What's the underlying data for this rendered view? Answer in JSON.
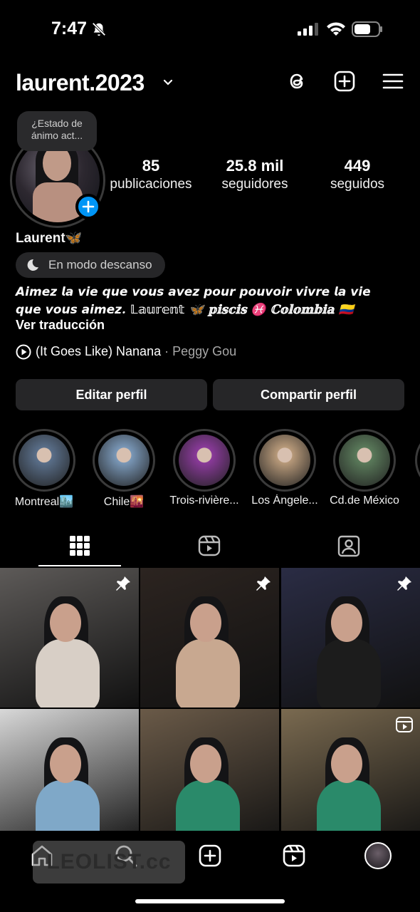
{
  "status_bar": {
    "time": "7:47"
  },
  "header": {
    "username": "laurent.2023"
  },
  "profile": {
    "note": "¿Estado de ánimo act...",
    "stats": [
      {
        "num": "85",
        "label": "publicaciones"
      },
      {
        "num": "25.8 mil",
        "label": "seguidores"
      },
      {
        "num": "449",
        "label": "seguidos"
      }
    ],
    "display_name": "Laurent🦋",
    "rest_mode": "En modo descanso",
    "bio": "𝘼𝙞𝙢𝙚𝙯 𝙡𝙖 𝙫𝙞𝙚 𝙦𝙪𝙚 𝙫𝙤𝙪𝙨 𝙖𝙫𝙚𝙯 𝙥𝙤𝙪𝙧 𝙥𝙤𝙪𝙫𝙤𝙞𝙧 𝙫𝙞𝙫𝙧𝙚 𝙡𝙖 𝙫𝙞𝙚 𝙦𝙪𝙚 𝙫𝙤𝙪𝙨 𝙖𝙞𝙢𝙚𝙯. 𝕃𝕒𝕦𝕣𝕖𝕟𝕥 🦋 𝕡𝕚𝕤𝕔𝕚𝕤 ♓ ℂ𝕠𝕝𝕠𝕞𝕓𝕚𝕒 🇨🇴",
    "translate": "Ver traducción",
    "song_title": "(It Goes Like) Nanana",
    "song_artist": " · Peggy Gou"
  },
  "buttons": {
    "edit": "Editar perfil",
    "share": "Compartir perfil"
  },
  "highlights": [
    {
      "label": "Montreal🏙️",
      "color": "#5a6f8a"
    },
    {
      "label": "Chile🌇",
      "color": "#7a98b8"
    },
    {
      "label": "Trois-rivière...",
      "color": "#8a3a9a"
    },
    {
      "label": "Los Ángele...",
      "color": "#b89a7a"
    },
    {
      "label": "Cd.de México",
      "color": "#5a7a5a"
    }
  ],
  "tabs": [
    "grid-icon",
    "reels-icon",
    "tagged-icon"
  ],
  "posts": [
    {
      "bg": "#5d5a58",
      "fig": "#d8cfc6",
      "pinned": true
    },
    {
      "bg": "#2c2420",
      "fig": "#c8a890",
      "pinned": true
    },
    {
      "bg": "#2a2c44",
      "fig": "#1c1c1c",
      "pinned": true
    },
    {
      "bg": "#d8d8d8",
      "fig": "#7fa8c8",
      "pinned": false
    },
    {
      "bg": "#6a5a48",
      "fig": "#2a8a6a",
      "pinned": false
    },
    {
      "bg": "#7a6a50",
      "fig": "#2a8a6a",
      "reel": true
    }
  ],
  "watermark": "LEOLIST.cc",
  "colors": {
    "accent": "#0095f6",
    "button_bg": "#262628",
    "background": "#000000"
  }
}
